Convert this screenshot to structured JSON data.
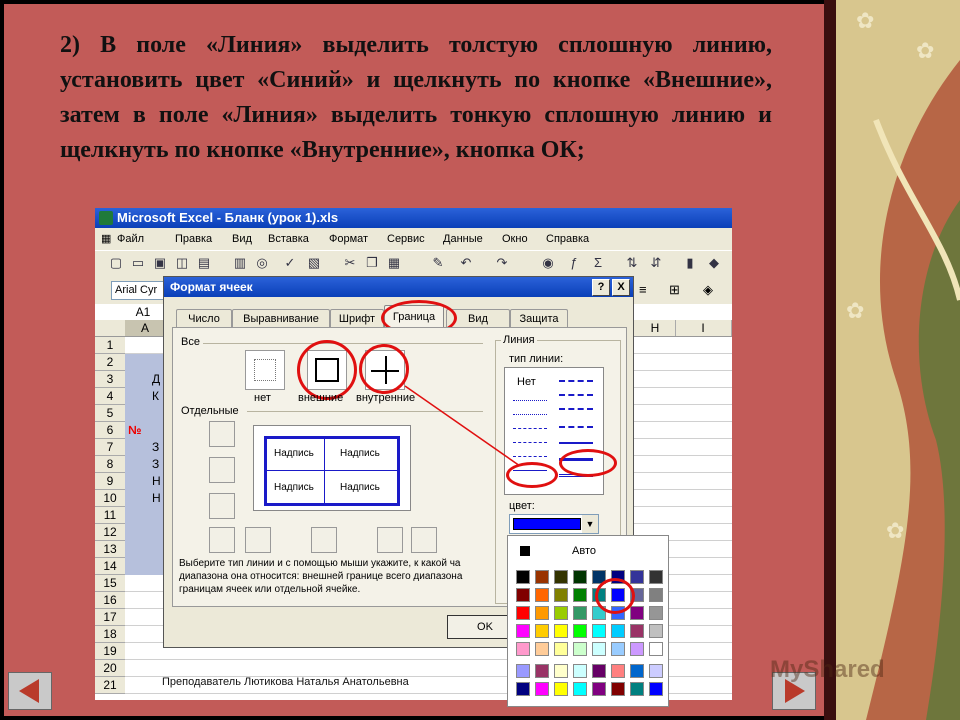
{
  "slide": {
    "instruction": [
      "2)      В поле «Линия» выделить толстую сплошную",
      "линию, установить цвет «Синий» и щелкнуть по",
      "кнопке «Внешние», затем в поле «Линия» выделить",
      "тонкую сплошную линию и щелкнуть по кнопке",
      "«Внутренние», кнопка ОК;"
    ],
    "footer": "Преподаватель Лютикова Наталья Анатольевна",
    "watermark": "MyShared",
    "colors": {
      "background": "#c25b58",
      "accent_ring": "#e01010",
      "border_blue": "#1a1ac8"
    }
  },
  "excel": {
    "title": "Microsoft Excel - Бланк (урок 1).xls",
    "menu": [
      "Файл",
      "Правка",
      "Вид",
      "Вставка",
      "Формат",
      "Сервис",
      "Данные",
      "Окно",
      "Справка"
    ],
    "toolbar_icons": [
      "new-icon",
      "open-icon",
      "save-icon",
      "permission-icon",
      "print-preview-icon",
      "print-icon",
      "preview-icon",
      "spelling-icon",
      "research-icon",
      "cut-icon",
      "copy-icon",
      "paste-icon",
      "format-painter-icon",
      "undo-icon",
      "redo-icon",
      "hyperlink-icon",
      "function-icon",
      "autosum-icon",
      "sort-asc-icon",
      "sort-desc-icon",
      "chart-icon",
      "drawing-icon"
    ],
    "font_name": "Arial Cyr",
    "name_box": "A1",
    "columns": [
      "A",
      "H",
      "I"
    ],
    "rows": [
      "1",
      "2",
      "3",
      "4",
      "5",
      "6",
      "7",
      "8",
      "9",
      "10",
      "11",
      "12",
      "13",
      "14",
      "15",
      "16",
      "17",
      "18",
      "19",
      "20",
      "21"
    ],
    "cells": {
      "r3": "Д",
      "r4": "К",
      "r6": "№",
      "r7": "З",
      "r8": "З",
      "r9": "Н",
      "r10": "Н"
    }
  },
  "dialog": {
    "title": "Формат ячеек",
    "help_btn": "?",
    "close_btn": "X",
    "tabs": [
      "Число",
      "Выравнивание",
      "Шрифт",
      "Граница",
      "Вид",
      "Защита"
    ],
    "active_tab": "Граница",
    "presets_label": "Все",
    "presets": [
      "нет",
      "внешние",
      "внутренние"
    ],
    "individual_label": "Отдельные",
    "preview_text": "Надпись",
    "line_group": "Линия",
    "line_type_label": "тип линии:",
    "line_none": "Нет",
    "color_label": "цвет:",
    "selected_color": "#0000ff",
    "hint": [
      "Выберите тип линии и с помощью мыши укажите, к какой ча",
      "диапазона она относится: внешней границе всего диапазона",
      "границам ячеек или отдельной ячейке."
    ],
    "ok": "OK",
    "palette_auto": "Авто",
    "palette": [
      [
        "#000000",
        "#993300",
        "#333300",
        "#003300",
        "#003366",
        "#000080",
        "#333399",
        "#333333"
      ],
      [
        "#800000",
        "#ff6600",
        "#808000",
        "#008000",
        "#008080",
        "#0000ff",
        "#666699",
        "#808080"
      ],
      [
        "#ff0000",
        "#ff9900",
        "#99cc00",
        "#339966",
        "#33cccc",
        "#3366ff",
        "#800080",
        "#969696"
      ],
      [
        "#ff00ff",
        "#ffcc00",
        "#ffff00",
        "#00ff00",
        "#00ffff",
        "#00ccff",
        "#993366",
        "#c0c0c0"
      ],
      [
        "#ff99cc",
        "#ffcc99",
        "#ffff99",
        "#ccffcc",
        "#ccffff",
        "#99ccff",
        "#cc99ff",
        "#ffffff"
      ],
      [
        "#9999ff",
        "#993366",
        "#ffffcc",
        "#ccffff",
        "#660066",
        "#ff8080",
        "#0066cc",
        "#ccccff"
      ],
      [
        "#000080",
        "#ff00ff",
        "#ffff00",
        "#00ffff",
        "#800080",
        "#800000",
        "#008080",
        "#0000ff"
      ]
    ]
  }
}
